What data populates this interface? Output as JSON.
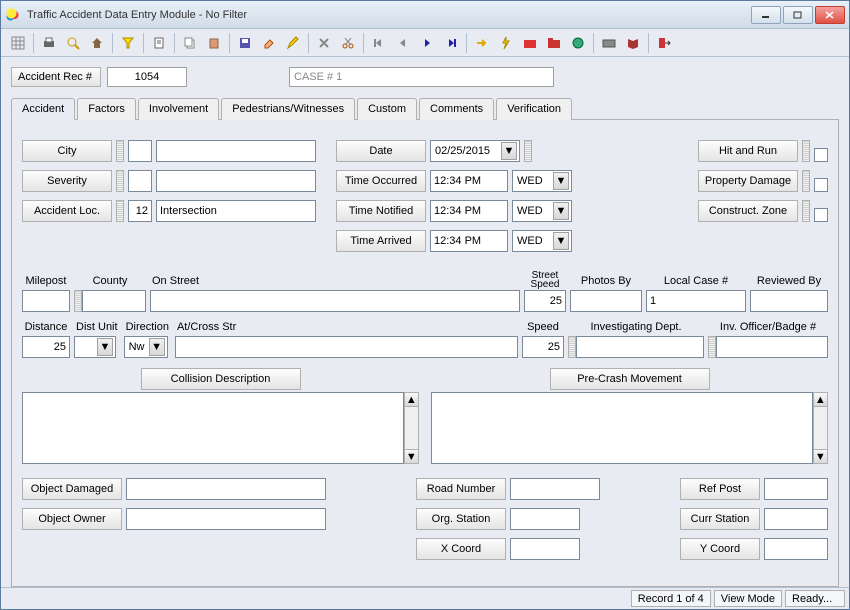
{
  "window": {
    "title": "Traffic Accident Data Entry Module - No Filter"
  },
  "header": {
    "rec_label": "Accident Rec #",
    "rec_value": "1054",
    "case_label": "CASE # 1"
  },
  "tabs": [
    "Accident",
    "Factors",
    "Involvement",
    "Pedestrians/Witnesses",
    "Custom",
    "Comments",
    "Verification"
  ],
  "left": {
    "city": "City",
    "severity": "Severity",
    "loc": "Accident Loc.",
    "loc_code": "12",
    "loc_text": "Intersection"
  },
  "mid": {
    "date_lbl": "Date",
    "date_val": "02/25/2015",
    "t_occ_lbl": "Time Occurred",
    "t_occ_val": "12:34 PM",
    "t_occ_day": "WED",
    "t_not_lbl": "Time Notified",
    "t_not_val": "12:34 PM",
    "t_not_day": "WED",
    "t_arr_lbl": "Time Arrived",
    "t_arr_val": "12:34 PM",
    "t_arr_day": "WED"
  },
  "right": {
    "hitrun": "Hit and Run",
    "propdmg": "Property Damage",
    "constr": "Construct. Zone"
  },
  "row2": {
    "milepost": "Milepost",
    "county": "County",
    "onstreet": "On Street",
    "streetspeed_lbl": "Street\nSpeed",
    "streetspeed_val": "25",
    "photosby": "Photos By",
    "localcase_lbl": "Local Case #",
    "localcase_val": "1",
    "reviewedby": "Reviewed By"
  },
  "row3": {
    "distance_lbl": "Distance",
    "distance_val": "25",
    "distunit_lbl": "Dist Unit",
    "direction_lbl": "Direction",
    "direction_val": "Nw",
    "atcross": "At/Cross Str",
    "speed_lbl": "Speed",
    "speed_val": "25",
    "invdept": "Investigating Dept.",
    "invoff": "Inv. Officer/Badge #"
  },
  "desc": {
    "collision": "Collision Description",
    "precrash": "Pre-Crash Movement"
  },
  "bottom": {
    "objdmg": "Object Damaged",
    "objown": "Object Owner",
    "roadnum": "Road Number",
    "orgsta": "Org. Station",
    "xcoord": "X Coord",
    "refpost": "Ref Post",
    "currsta": "Curr Station",
    "ycoord": "Y Coord"
  },
  "status": {
    "record": "Record 1 of 4",
    "mode": "View Mode",
    "ready": "Ready..."
  }
}
